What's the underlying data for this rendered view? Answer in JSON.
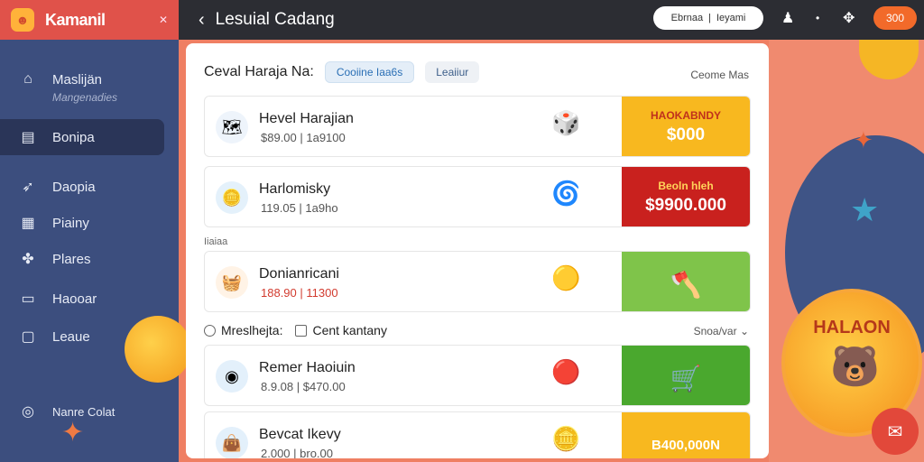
{
  "app": {
    "name": "Kamanil"
  },
  "sidebar": {
    "items": [
      {
        "label": "Maslijän",
        "sub": "Mangenadies",
        "icon": "home-icon"
      },
      {
        "label": "Bonipa",
        "icon": "gift-icon"
      },
      {
        "label": "Daopia",
        "icon": "rocket-icon"
      },
      {
        "label": "Piainy",
        "icon": "store-icon"
      },
      {
        "label": "Plares",
        "icon": "puzzle-icon"
      },
      {
        "label": "Haooar",
        "icon": "card-icon"
      },
      {
        "label": "Leaue",
        "icon": "chat-icon"
      }
    ],
    "footer": "Nanre Colat"
  },
  "topbar": {
    "title": "Lesuial Cadang",
    "search_left": "Ebrnaa",
    "search_right": "Ieyami",
    "coins": "300"
  },
  "panel": {
    "title": "Ceval Haraja  Na:",
    "chip_a": "Cooiine Iaa6s",
    "chip_b": "Leaiiur",
    "link": "Ceome Mas",
    "section_label": "Iiaiaa",
    "filter_a": "Mreslhejta:",
    "filter_b": "Cent kantany",
    "sort": "Snoa/var",
    "cards": [
      {
        "name": "Hevel Harajian",
        "meta": "$89.00  |  1a9100",
        "promo_line1": "HAOKABNDY",
        "promo_line2": "$000",
        "thumb": "map-icon",
        "deco": "dice-icon"
      },
      {
        "name": "Harlomisky",
        "meta": "119.05  |  1a9ho",
        "promo_line1": "Beoln hleh",
        "promo_line2": "$9900.000",
        "thumb": "coin-icon",
        "deco": "fan-icon"
      },
      {
        "name": "Donianricani",
        "meta": "188.90  |  11300",
        "promo_line1": "",
        "promo_line2": "",
        "thumb": "basket-icon",
        "deco": "coins-icon"
      },
      {
        "name": "Remer Haoiuin",
        "meta": "8.9.08  |  $470.00",
        "promo_line1": "",
        "promo_line2": "",
        "thumb": "target-icon",
        "deco": "cannon-icon"
      },
      {
        "name": "Bevcat Ikevy",
        "meta": "2.000  |  bro.00",
        "promo_line1": "B400,000N",
        "promo_line2": "",
        "thumb": "bag-icon",
        "deco": "coin-stack-icon"
      }
    ]
  },
  "badge": {
    "text": "HALAON"
  }
}
